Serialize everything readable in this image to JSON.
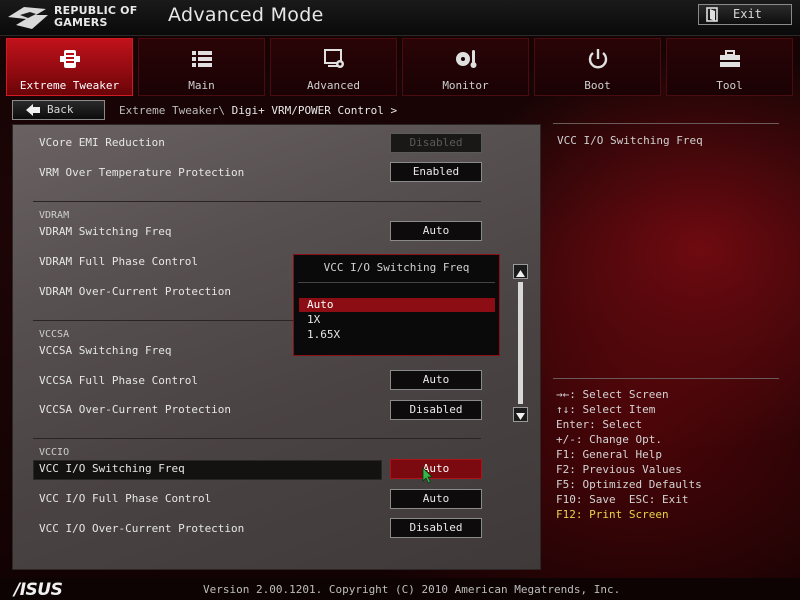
{
  "brand": {
    "line1": "REPUBLIC OF",
    "line2": "GAMERS",
    "footer_logo": "/ISUS"
  },
  "window": {
    "title": "Advanced Mode",
    "exit_label": "Exit"
  },
  "tabs": [
    {
      "label": "Extreme Tweaker",
      "icon": "tweaker-icon",
      "active": true
    },
    {
      "label": "Main",
      "icon": "list-icon",
      "active": false
    },
    {
      "label": "Advanced",
      "icon": "advanced-icon",
      "active": false
    },
    {
      "label": "Monitor",
      "icon": "thermometer-fan-icon",
      "active": false
    },
    {
      "label": "Boot",
      "icon": "power-icon",
      "active": false
    },
    {
      "label": "Tool",
      "icon": "toolbox-icon",
      "active": false
    }
  ],
  "nav": {
    "back_label": "Back",
    "breadcrumb_parent": "Extreme Tweaker\\",
    "breadcrumb_current": " Digi+ VRM/POWER Control >"
  },
  "settings": {
    "vcore_emi": {
      "label": "VCore EMI Reduction",
      "value": "Disabled"
    },
    "vrm_otp": {
      "label": "VRM Over Temperature Protection",
      "value": "Enabled"
    },
    "vdram_section": "VDRAM",
    "vdram_freq": {
      "label": "VDRAM Switching Freq",
      "value": "Auto"
    },
    "vdram_phase": {
      "label": "VDRAM Full Phase Control"
    },
    "vdram_ocp": {
      "label": "VDRAM Over-Current Protection"
    },
    "vccsa_section": "VCCSA",
    "vccsa_freq": {
      "label": "VCCSA Switching Freq"
    },
    "vccsa_phase": {
      "label": "VCCSA Full Phase Control",
      "value": "Auto"
    },
    "vccsa_ocp": {
      "label": "VCCSA Over-Current Protection",
      "value": "Disabled"
    },
    "vccio_section": "VCCIO",
    "vccio_freq": {
      "label": "VCC I/O Switching Freq",
      "value": "Auto"
    },
    "vccio_phase": {
      "label": "VCC I/O Full Phase Control",
      "value": "Auto"
    },
    "vccio_ocp": {
      "label": "VCC I/O Over-Current Protection",
      "value": "Disabled"
    }
  },
  "popup": {
    "title": "VCC I/O Switching Freq",
    "options": [
      "Auto",
      "1X",
      "1.65X"
    ],
    "selected": "Auto"
  },
  "help": {
    "description": "VCC I/O Switching Freq",
    "keys": [
      "→←: Select Screen",
      "↑↓: Select Item",
      "Enter: Select",
      "+/-: Change Opt.",
      "F1: General Help",
      "F2: Previous Values",
      "F5: Optimized Defaults",
      "F10: Save  ESC: Exit"
    ],
    "key_highlight": "F12: Print Screen"
  },
  "footer": {
    "version": "Version 2.00.1201. Copyright (C) 2010 American Megatrends, Inc."
  },
  "colors": {
    "accent": "#b5101a",
    "panel": "#575050",
    "highlight_text": "#e8d44a"
  }
}
